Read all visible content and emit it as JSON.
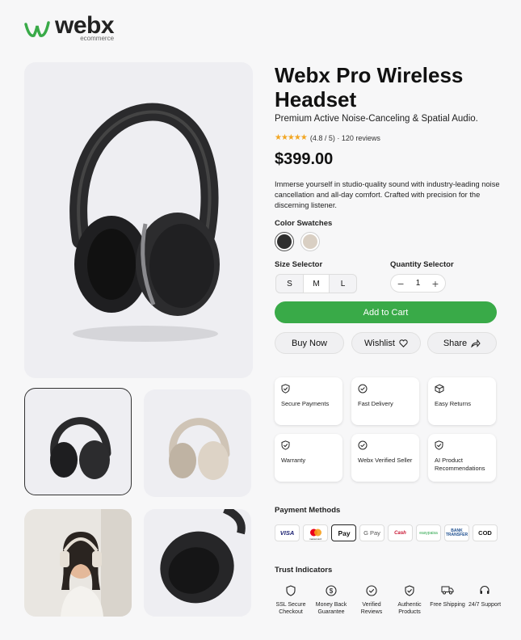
{
  "logo": {
    "word": "webx",
    "sub": "ecommerce"
  },
  "product": {
    "title": "Webx Pro Wireless Headset",
    "subtitle": "Premium Active Noise-Canceling & Spatial Audio.",
    "stars": "★★★★★",
    "rating": "(4.8 / 5) · 120 reviews",
    "price": "$399.00",
    "description": "Immerse yourself in studio-quality sound with industry-leading noise cancellation and all-day comfort. Crafted with precision for the discerning listener."
  },
  "swatches": {
    "label": "Color Swatches",
    "colors": [
      "#2e2e2e",
      "#d9cfc3"
    ]
  },
  "size": {
    "label": "Size Selector",
    "options": [
      "S",
      "M",
      "L"
    ],
    "selected": "M"
  },
  "quantity": {
    "label": "Quantity Selector",
    "value": "1",
    "minus": "−",
    "plus": "+"
  },
  "actions": {
    "add_to_cart": "Add to Cart",
    "buy_now": "Buy Now",
    "wishlist": "Wishlist",
    "share": "Share"
  },
  "features": [
    {
      "label": "Secure Payments",
      "icon": "shield-check-icon"
    },
    {
      "label": "Fast Delivery",
      "icon": "check-circle-icon"
    },
    {
      "label": "Easy Returns",
      "icon": "box-icon"
    },
    {
      "label": "Warranty",
      "icon": "shield-check-icon"
    },
    {
      "label": "Webx Verified Seller",
      "icon": "check-circle-icon"
    },
    {
      "label": "AI Product Recommendations",
      "icon": "shield-check-icon"
    }
  ],
  "payment": {
    "label": "Payment Methods",
    "methods": [
      "VISA",
      "mastercard",
      "Pay",
      "G Pay",
      "Cash",
      "easypaisa",
      "BANK TRANSFER",
      "COD"
    ]
  },
  "trust": {
    "label": "Trust Indicators",
    "items": [
      {
        "label": "SSL Secure Checkout",
        "icon": "shield-icon"
      },
      {
        "label": "Money Back Guarantee",
        "icon": "dollar-badge-icon"
      },
      {
        "label": "Verified Reviews",
        "icon": "check-circle-icon"
      },
      {
        "label": "Authentic Products",
        "icon": "shield-check-icon"
      },
      {
        "label": "Free Shipping",
        "icon": "truck-icon"
      },
      {
        "label": "24/7 Support",
        "icon": "headset-icon"
      }
    ]
  },
  "colors": {
    "accent": "#39aa48",
    "star": "#f2a623"
  }
}
